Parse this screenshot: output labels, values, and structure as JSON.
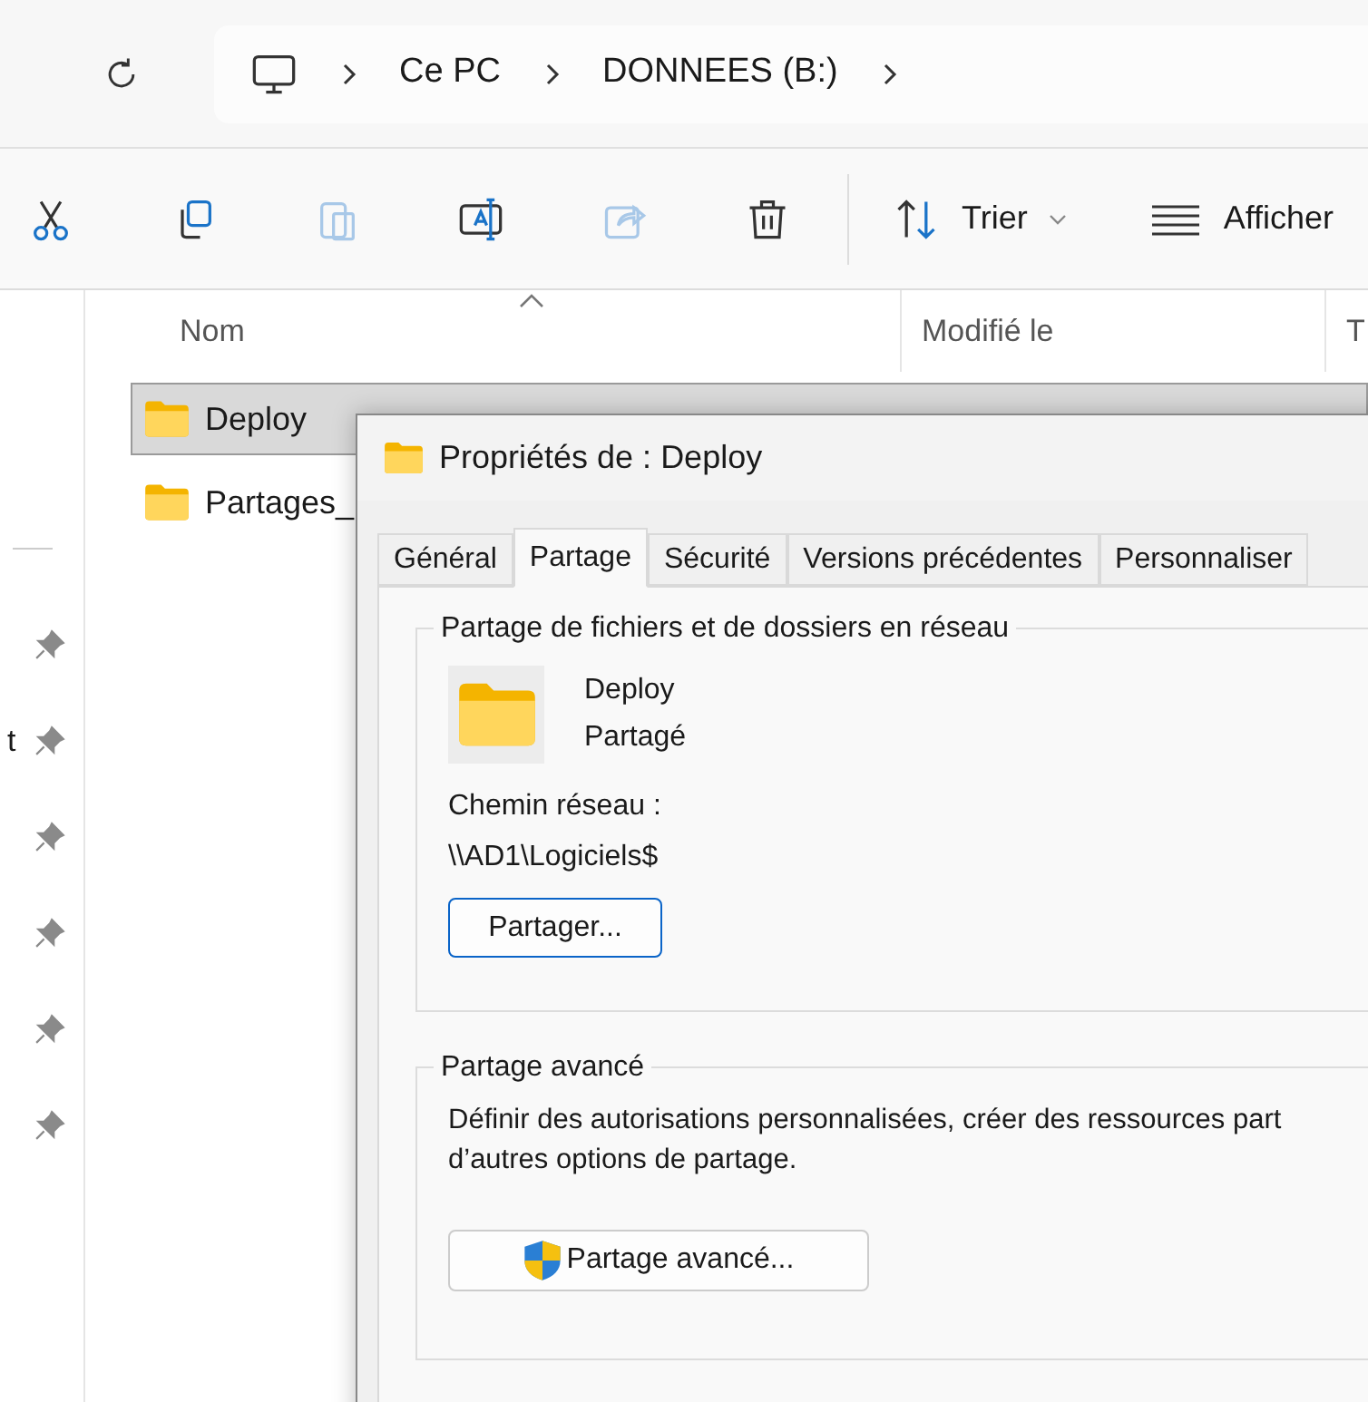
{
  "breadcrumb": [
    "Ce PC",
    "DONNEES (B:)"
  ],
  "toolbar": {
    "items": [
      {
        "kind": "cut",
        "disabled": false
      },
      {
        "kind": "copy",
        "disabled": false
      },
      {
        "kind": "paste",
        "disabled": true
      },
      {
        "kind": "rename",
        "disabled": false
      },
      {
        "kind": "share",
        "disabled": true
      },
      {
        "kind": "delete",
        "disabled": false
      }
    ],
    "sort": "Trier",
    "view": "Afficher"
  },
  "sidebar": {
    "partial_label": "t"
  },
  "file_list": {
    "columns": [
      "Nom",
      "Modifié le",
      "T"
    ],
    "rows": [
      {
        "name": "Deploy",
        "selected": true
      },
      {
        "name": "Partages_",
        "selected": false
      }
    ]
  },
  "dialog": {
    "title": "Propriétés de : Deploy",
    "tabs": [
      {
        "label": "Général",
        "selected": false
      },
      {
        "label": "Partage",
        "selected": true
      },
      {
        "label": "Sécurité",
        "selected": false
      },
      {
        "label": "Versions précédentes",
        "selected": false
      },
      {
        "label": "Personnaliser",
        "selected": false
      }
    ],
    "network_sharing": {
      "title": "Partage de fichiers et de dossiers en réseau",
      "folder_name": "Deploy",
      "status": "Partagé",
      "path_label": "Chemin réseau :",
      "path": "\\\\AD1\\Logiciels$",
      "button": "Partager..."
    },
    "advanced_sharing": {
      "title": "Partage avancé",
      "description": "Définir des autorisations personnalisées, créer des ressources part\nd’autres options de partage.",
      "button": "Partage avancé..."
    }
  }
}
